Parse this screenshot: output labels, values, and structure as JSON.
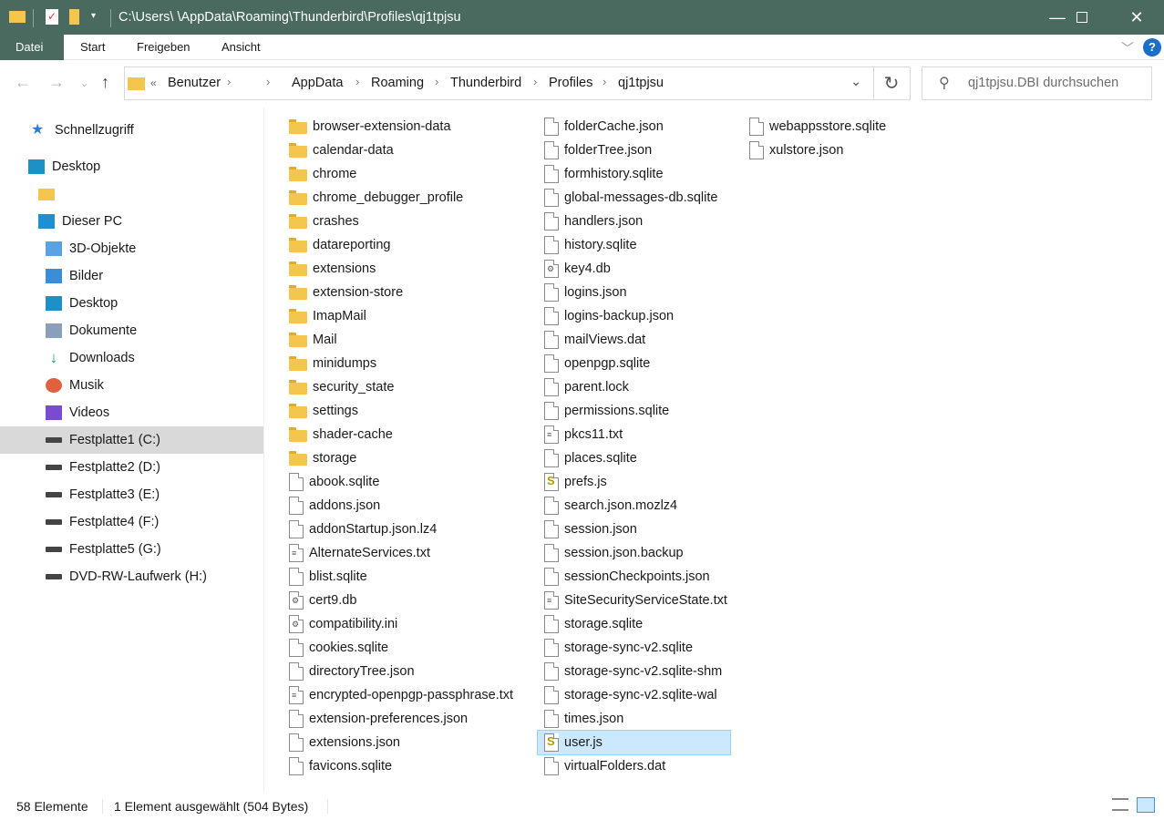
{
  "window": {
    "title": "C:\\Users\\       \\AppData\\Roaming\\Thunderbird\\Profiles\\qj1tpjsu",
    "accent": "#4a6a60"
  },
  "ribbon": {
    "tabs": [
      "Datei",
      "Start",
      "Freigeben",
      "Ansicht"
    ]
  },
  "address": {
    "crumbs": [
      "Benutzer",
      "",
      "AppData",
      "Roaming",
      "Thunderbird",
      "Profiles",
      "qj1tpjsu"
    ],
    "overflow": "«"
  },
  "search": {
    "placeholder": "qj1tpjsu.DBI durchsuchen"
  },
  "sidebar": [
    {
      "label": "Schnellzugriff",
      "icon": "star-icon"
    },
    {
      "label": "Desktop",
      "icon": "desktop-icon"
    },
    {
      "label": "",
      "icon": "folder-icon"
    },
    {
      "label": "Dieser PC",
      "icon": "computer-icon"
    },
    {
      "label": "3D-Objekte",
      "icon": "cube-icon"
    },
    {
      "label": "Bilder",
      "icon": "pictures-icon"
    },
    {
      "label": "Desktop",
      "icon": "desktop-icon"
    },
    {
      "label": "Dokumente",
      "icon": "documents-icon"
    },
    {
      "label": "Downloads",
      "icon": "download-icon"
    },
    {
      "label": "Musik",
      "icon": "music-icon"
    },
    {
      "label": "Videos",
      "icon": "video-icon"
    },
    {
      "label": "Festplatte1 (C:)",
      "icon": "drive-icon",
      "selected": true
    },
    {
      "label": "Festplatte2 (D:)",
      "icon": "drive-icon"
    },
    {
      "label": "Festplatte3 (E:)",
      "icon": "drive-icon"
    },
    {
      "label": "Festplatte4 (F:)",
      "icon": "drive-icon"
    },
    {
      "label": "Festplatte5 (G:)",
      "icon": "drive-icon"
    },
    {
      "label": "DVD-RW-Laufwerk (H:)",
      "icon": "dvd-drive-icon"
    }
  ],
  "files": [
    {
      "name": "browser-extension-data",
      "type": "folder"
    },
    {
      "name": "calendar-data",
      "type": "folder"
    },
    {
      "name": "chrome",
      "type": "folder"
    },
    {
      "name": "chrome_debugger_profile",
      "type": "folder"
    },
    {
      "name": "crashes",
      "type": "folder"
    },
    {
      "name": "datareporting",
      "type": "folder"
    },
    {
      "name": "extensions",
      "type": "folder"
    },
    {
      "name": "extension-store",
      "type": "folder"
    },
    {
      "name": "ImapMail",
      "type": "folder"
    },
    {
      "name": "Mail",
      "type": "folder"
    },
    {
      "name": "minidumps",
      "type": "folder"
    },
    {
      "name": "security_state",
      "type": "folder"
    },
    {
      "name": "settings",
      "type": "folder"
    },
    {
      "name": "shader-cache",
      "type": "folder"
    },
    {
      "name": "storage",
      "type": "folder"
    },
    {
      "name": "abook.sqlite",
      "type": "file"
    },
    {
      "name": "addons.json",
      "type": "file"
    },
    {
      "name": "addonStartup.json.lz4",
      "type": "file"
    },
    {
      "name": "AlternateServices.txt",
      "type": "text"
    },
    {
      "name": "blist.sqlite",
      "type": "file"
    },
    {
      "name": "cert9.db",
      "type": "db"
    },
    {
      "name": "compatibility.ini",
      "type": "ini"
    },
    {
      "name": "cookies.sqlite",
      "type": "file"
    },
    {
      "name": "directoryTree.json",
      "type": "file"
    },
    {
      "name": "encrypted-openpgp-passphrase.txt",
      "type": "text"
    },
    {
      "name": "extension-preferences.json",
      "type": "file"
    },
    {
      "name": "extensions.json",
      "type": "file"
    },
    {
      "name": "favicons.sqlite",
      "type": "file"
    },
    {
      "name": "folderCache.json",
      "type": "file"
    },
    {
      "name": "folderTree.json",
      "type": "file"
    },
    {
      "name": "formhistory.sqlite",
      "type": "file"
    },
    {
      "name": "global-messages-db.sqlite",
      "type": "file"
    },
    {
      "name": "handlers.json",
      "type": "file"
    },
    {
      "name": "history.sqlite",
      "type": "file"
    },
    {
      "name": "key4.db",
      "type": "db"
    },
    {
      "name": "logins.json",
      "type": "file"
    },
    {
      "name": "logins-backup.json",
      "type": "file"
    },
    {
      "name": "mailViews.dat",
      "type": "file"
    },
    {
      "name": "openpgp.sqlite",
      "type": "file"
    },
    {
      "name": "parent.lock",
      "type": "file"
    },
    {
      "name": "permissions.sqlite",
      "type": "file"
    },
    {
      "name": "pkcs11.txt",
      "type": "text"
    },
    {
      "name": "places.sqlite",
      "type": "file"
    },
    {
      "name": "prefs.js",
      "type": "script"
    },
    {
      "name": "search.json.mozlz4",
      "type": "file"
    },
    {
      "name": "session.json",
      "type": "file"
    },
    {
      "name": "session.json.backup",
      "type": "file"
    },
    {
      "name": "sessionCheckpoints.json",
      "type": "file"
    },
    {
      "name": "SiteSecurityServiceState.txt",
      "type": "text"
    },
    {
      "name": "storage.sqlite",
      "type": "file"
    },
    {
      "name": "storage-sync-v2.sqlite",
      "type": "file"
    },
    {
      "name": "storage-sync-v2.sqlite-shm",
      "type": "file"
    },
    {
      "name": "storage-sync-v2.sqlite-wal",
      "type": "file"
    },
    {
      "name": "times.json",
      "type": "file"
    },
    {
      "name": "user.js",
      "type": "script",
      "selected": true
    },
    {
      "name": "virtualFolders.dat",
      "type": "file"
    },
    {
      "name": "webappsstore.sqlite",
      "type": "file"
    },
    {
      "name": "xulstore.json",
      "type": "file"
    }
  ],
  "status": {
    "count": "58 Elemente",
    "selection": "1 Element ausgewählt (504 Bytes)"
  }
}
